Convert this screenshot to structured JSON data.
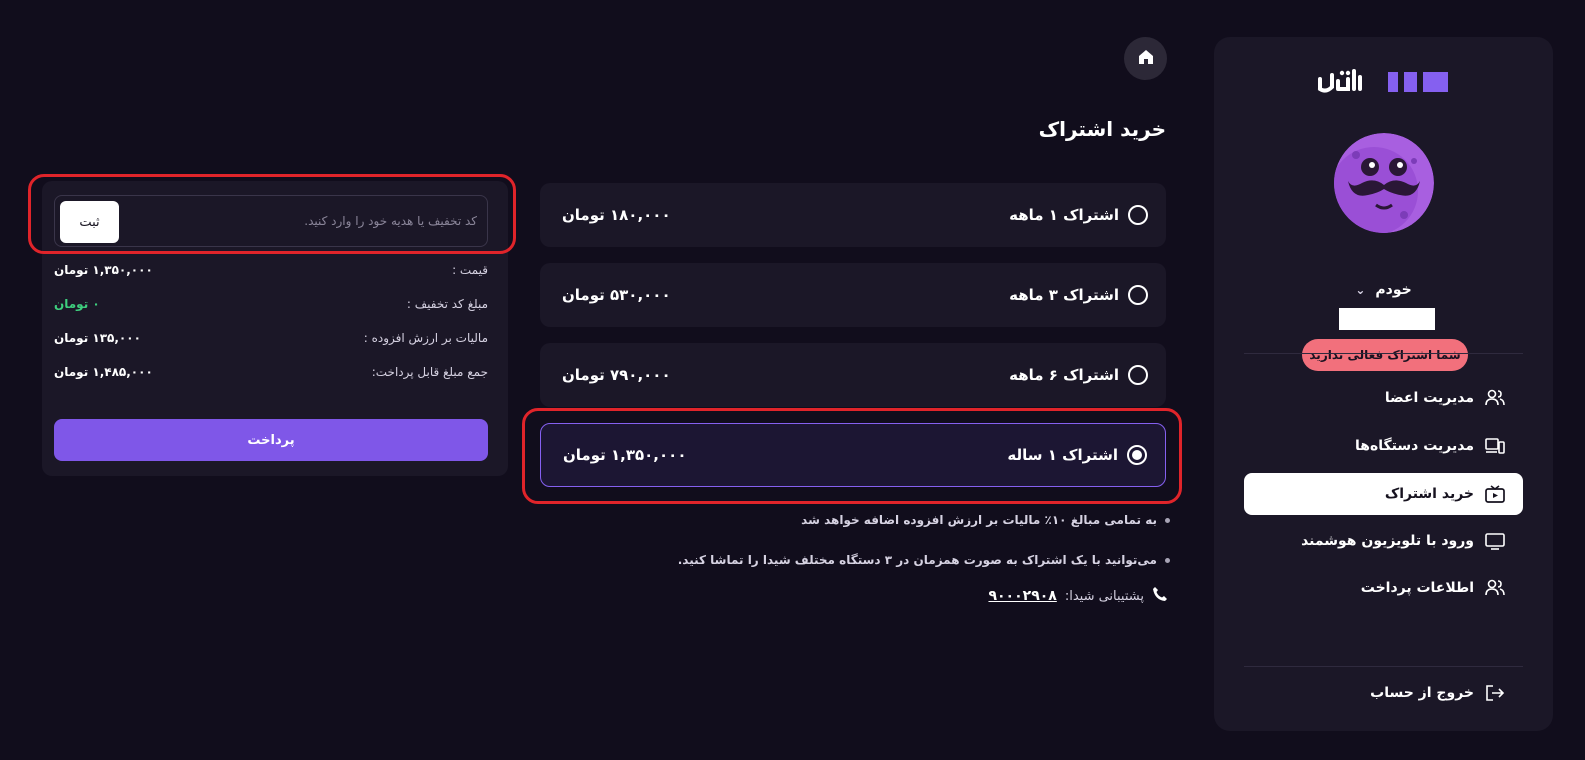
{
  "brand": {
    "logo_text": "شیدا",
    "accent": "#8560f0"
  },
  "sidebar": {
    "profile_name": "خودم",
    "status_badge": "شما اشتراک فعالی ندارید",
    "status_color": "#f2707c",
    "items": [
      {
        "label": "مدیریت اعضا",
        "icon": "users-icon",
        "active": false
      },
      {
        "label": "مدیریت دستگاه‌ها",
        "icon": "devices-icon",
        "active": false
      },
      {
        "label": "خرید اشتراک",
        "icon": "play-box-icon",
        "active": true
      },
      {
        "label": "ورود با تلویزیون هوشمند",
        "icon": "tv-icon",
        "active": false
      },
      {
        "label": "اطلاعات پرداخت",
        "icon": "users-icon",
        "active": false
      }
    ],
    "logout_label": "خروج از حساب"
  },
  "main": {
    "title": "خرید اشتراک",
    "plans": [
      {
        "name": "اشتراک ۱ ماهه",
        "price": "۱۸۰,۰۰۰ تومان",
        "selected": false
      },
      {
        "name": "اشتراک ۳ ماهه",
        "price": "۵۳۰,۰۰۰ تومان",
        "selected": false
      },
      {
        "name": "اشتراک ۶ ماهه",
        "price": "۷۹۰,۰۰۰ تومان",
        "selected": false
      },
      {
        "name": "اشتراک ۱ ساله",
        "price": "۱,۳۵۰,۰۰۰ تومان",
        "selected": true
      }
    ],
    "notes": [
      "به تمامی مبالغ ۱۰٪ مالیات بر ارزش افزوده اضافه خواهد شد",
      "می‌توانید با یک اشتراک به صورت همزمان در ۳ دستگاه مختلف شیدا را تماشا کنید."
    ],
    "support_label": "پشتیبانی شیدا:",
    "support_phone": "۹۰۰۰۲۹۰۸"
  },
  "payment": {
    "coupon_placeholder": "کد تخفیف یا هدیه خود را وارد کنید.",
    "coupon_button": "ثبت",
    "rows": [
      {
        "label": "قیمت :",
        "value": "۱,۳۵۰,۰۰۰ تومان"
      },
      {
        "label": "مبلغ کد تخفیف :",
        "value": "۰ تومان"
      },
      {
        "label": "مالیات بر ارزش افزوده :",
        "value": "۱۳۵,۰۰۰ تومان"
      },
      {
        "label": "جمع مبلغ قابل پرداخت:",
        "value": "۱,۴۸۵,۰۰۰ تومان"
      }
    ],
    "pay_button": "پرداخت",
    "discount_color": "#3ecf7e"
  }
}
